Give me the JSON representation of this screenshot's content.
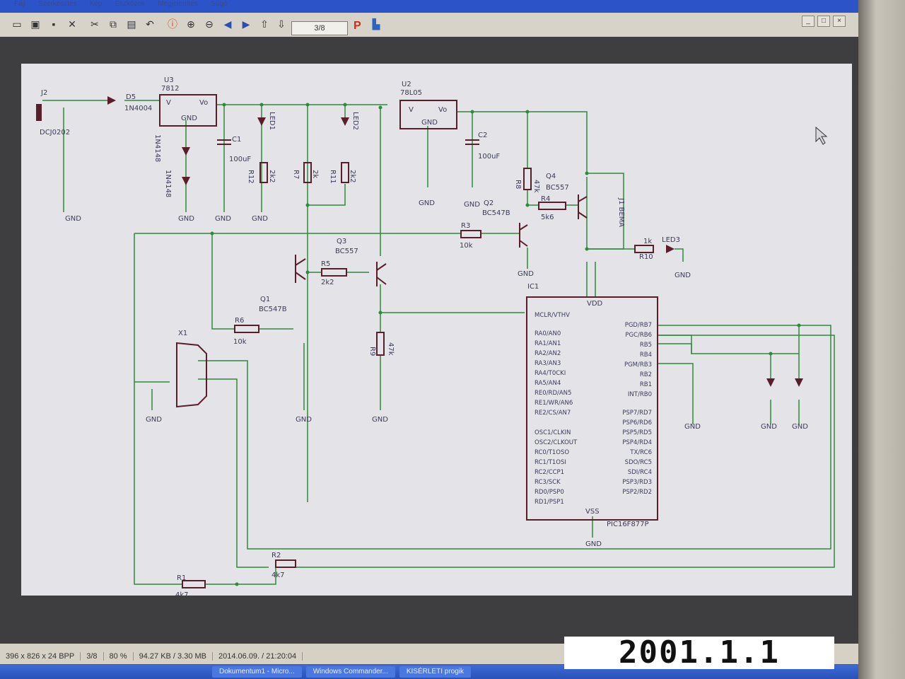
{
  "window": {
    "menu": [
      "Fájl",
      "Szerkesztés",
      "Kép",
      "Eszközök",
      "Megjelenítés",
      "Súgó"
    ],
    "controls": [
      "_",
      "□",
      "×"
    ]
  },
  "toolbar": {
    "page_indicator": "3/8",
    "icons": [
      "open-icon",
      "save-icon",
      "close-icon",
      "cut-icon",
      "copy-icon",
      "paste-icon",
      "undo-icon",
      "info-icon",
      "zoom-in-icon",
      "zoom-out-icon",
      "back-icon",
      "forward-icon",
      "prev-page-icon",
      "next-page-icon",
      "p-icon",
      "scanner-icon"
    ]
  },
  "schematic": {
    "labels": {
      "j2": "J2",
      "jack": "DCJ0202",
      "d5": "D5",
      "d5_val": "1N4004",
      "u3": "U3",
      "u3_val": "7812",
      "u3_v": "V",
      "u3_vo": "Vo",
      "u3_gnd": "GND",
      "d3": "1N4148",
      "d4": "1N4148",
      "c1": "C1",
      "c1_val": "100uF",
      "led1": "LED1",
      "r12": "R12",
      "r12_val": "2k2",
      "r7": "R7",
      "r7_val": "2k",
      "r11": "R11",
      "r11_val": "2k2",
      "led2": "LED2",
      "u2": "U2",
      "u2_val": "78L05",
      "u2_v": "V",
      "u2_vo": "Vo",
      "u2_gnd": "GND",
      "c2": "C2",
      "c2_val": "100uF",
      "r8": "R8",
      "r8_val": "47k",
      "q4": "Q4",
      "q4_val": "BC557",
      "q2": "Q2",
      "q2_val": "BC547B",
      "r4": "R4",
      "r4_val": "5k6",
      "j1": "J1 BEMA",
      "r3": "R3",
      "r3_val": "10k",
      "q3": "Q3",
      "q3_val": "BC557",
      "r5": "R5",
      "r5_val": "2k2",
      "r10": "R10",
      "r10_val": "1k",
      "led3": "LED3",
      "ic1": "IC1",
      "vdd": "VDD",
      "vss": "VSS",
      "ic_part": "PIC16F877P",
      "q1": "Q1",
      "q1_val": "BC547B",
      "r6": "R6",
      "r6_val": "10k",
      "r9": "R9",
      "r9_val": "47k",
      "x1": "X1",
      "r1": "R1",
      "r1_val": "4k7",
      "r2": "R2",
      "r2_val": "4k7",
      "gnd": "GND"
    },
    "pic_left_pins": [
      "MCLR/VTHV",
      "RA0/AN0",
      "RA1/AN1",
      "RA2/AN2",
      "RA3/AN3",
      "RA4/T0CKI",
      "RA5/AN4",
      "RE0/RD/AN5",
      "RE1/WR/AN6",
      "RE2/CS/AN7",
      "OSC1/CLKIN",
      "OSC2/CLKOUT",
      "RC0/T1OSO",
      "RC1/T1OSI",
      "RC2/CCP1",
      "RC3/SCK",
      "RD0/PSP0",
      "RD1/PSP1"
    ],
    "pic_right_pins": [
      "PGD/RB7",
      "PGC/RB6",
      "RB5",
      "RB4",
      "PGM/RB3",
      "RB2",
      "RB1",
      "INT/RB0",
      "PSP7/RD7",
      "PSP6/RD6",
      "PSP5/RD5",
      "PSP4/RD4",
      "TX/RC6",
      "SDO/RC5",
      "SDI/RC4",
      "PSP3/RD3",
      "PSP2/RD2"
    ]
  },
  "status": {
    "dimensions": "396 x 826 x 24 BPP",
    "page": "3/8",
    "zoom": "80 %",
    "size": "94.27 KB / 3.30 MB",
    "datetime": "2014.06.09. / 21:20:04"
  },
  "taskbar": {
    "tasks": [
      "Dokumentum1 - Micro...",
      "Windows Commander...",
      "KISÉRLETI progik"
    ]
  },
  "date_stamp": "2001.1.1"
}
